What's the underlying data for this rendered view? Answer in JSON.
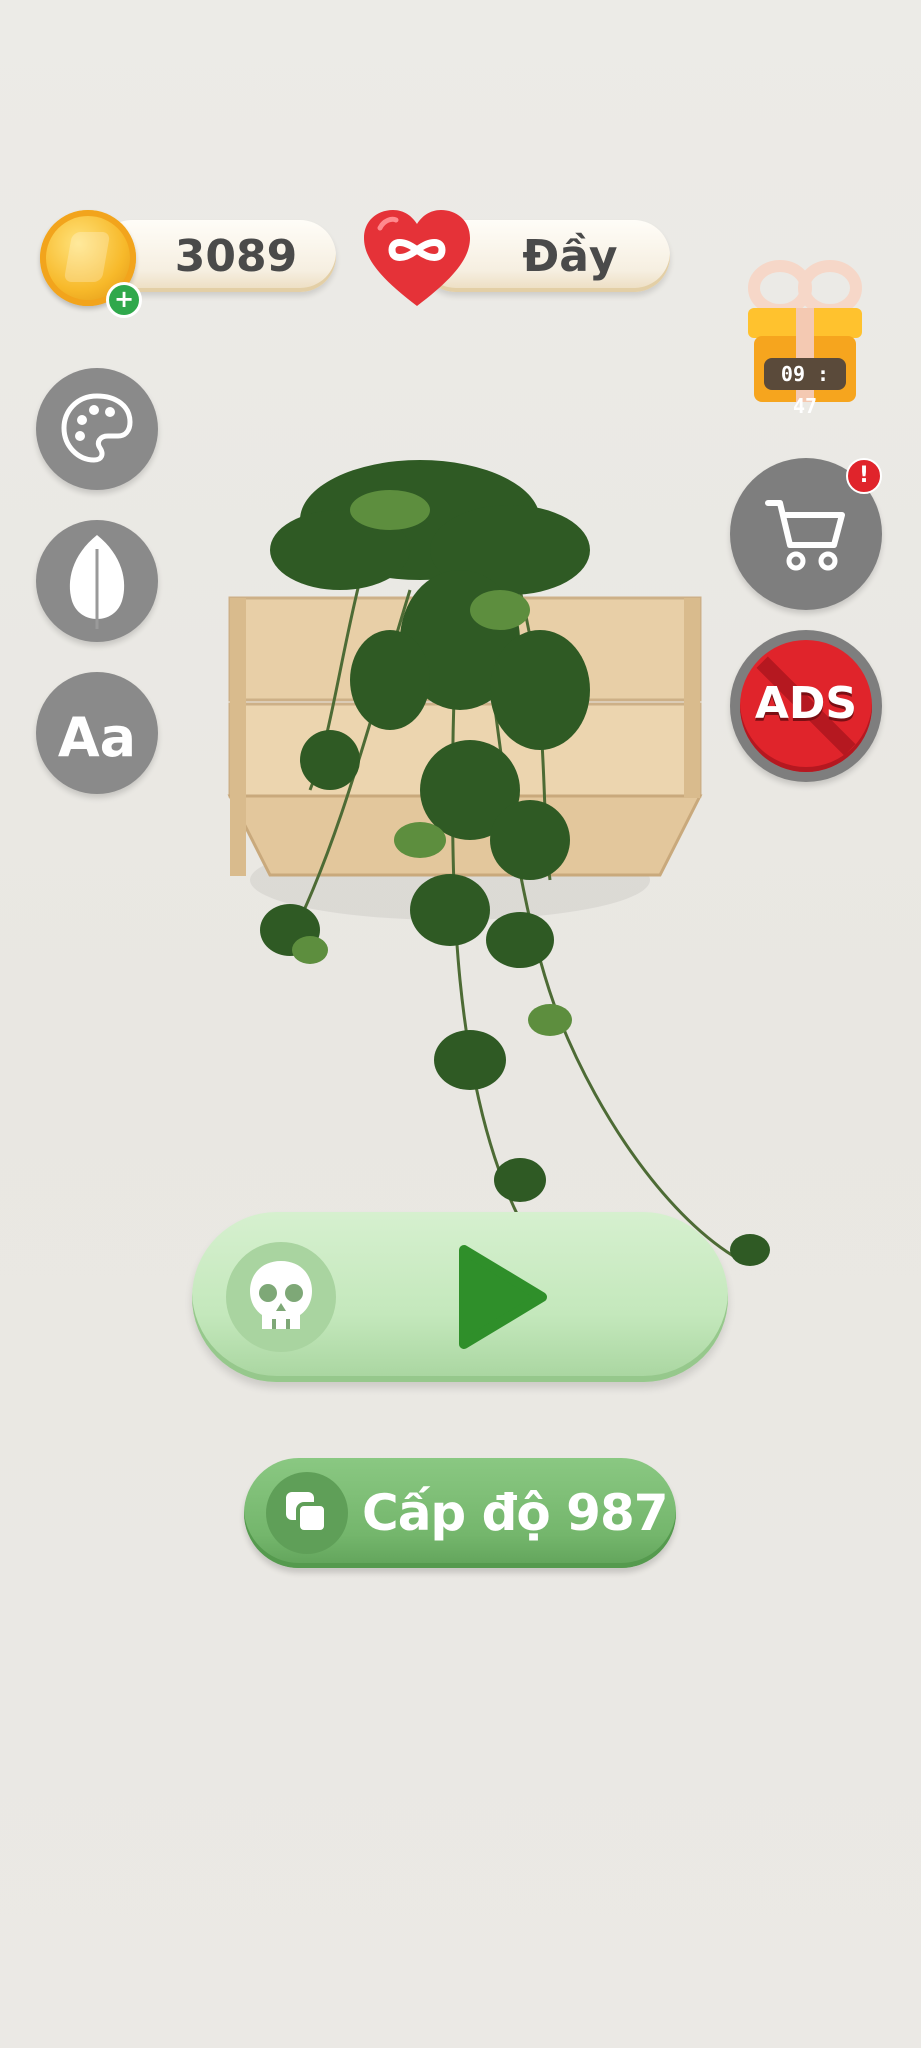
{
  "hud": {
    "coins": "3089",
    "lives": "Đầy",
    "gift_timer": "09 : 47",
    "cart_badge": "!",
    "no_ads_label": "ADS"
  },
  "side_buttons": {
    "theme": "palette-icon",
    "background": "leaf-icon",
    "font": "font-size-icon",
    "font_label": "Aa"
  },
  "main": {
    "level_label": "Cấp độ 987",
    "play_icon": "play-icon",
    "difficulty_icon": "skull-icon"
  },
  "colors": {
    "accent_green": "#2f8f2a",
    "play_bar": "#c4e8bc",
    "level_pill": "#74b66c",
    "heart": "#e53238",
    "no_ads_red": "#e0242b"
  }
}
